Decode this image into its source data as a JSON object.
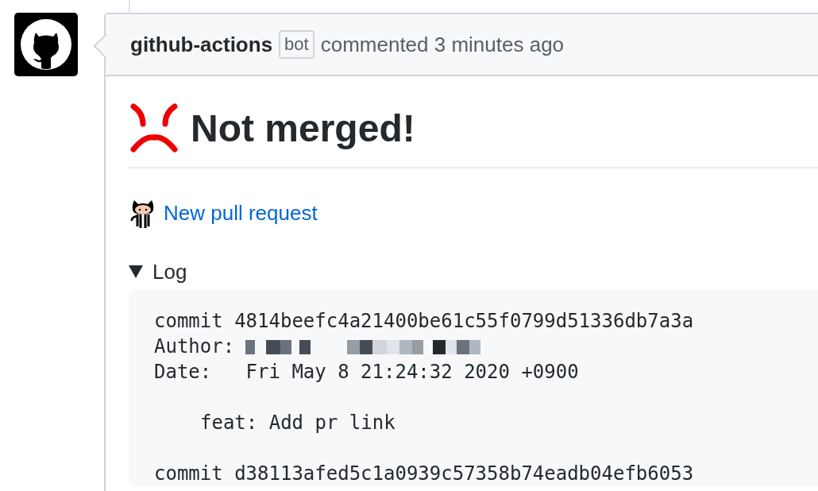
{
  "comment": {
    "author": "github-actions",
    "badge": "bot",
    "action": "commented 3 minutes ago",
    "heading": "Not merged!",
    "link": "New pull request",
    "details": {
      "summary": "Log",
      "expanded": true,
      "lines": [
        {
          "kind": "text",
          "text": "commit 4814beefc4a21400be61c55f0799d51336db7a3a"
        },
        {
          "kind": "redacted",
          "text": "Author:"
        },
        {
          "kind": "text",
          "text": "Date:   Fri May 8 21:24:32 2020 +0900"
        },
        {
          "kind": "blank"
        },
        {
          "kind": "indented",
          "text": "feat: Add pr link"
        },
        {
          "kind": "blank"
        },
        {
          "kind": "text",
          "text": "commit d38113afed5c1a0939c57358b74eadb04efb6053"
        }
      ]
    }
  }
}
